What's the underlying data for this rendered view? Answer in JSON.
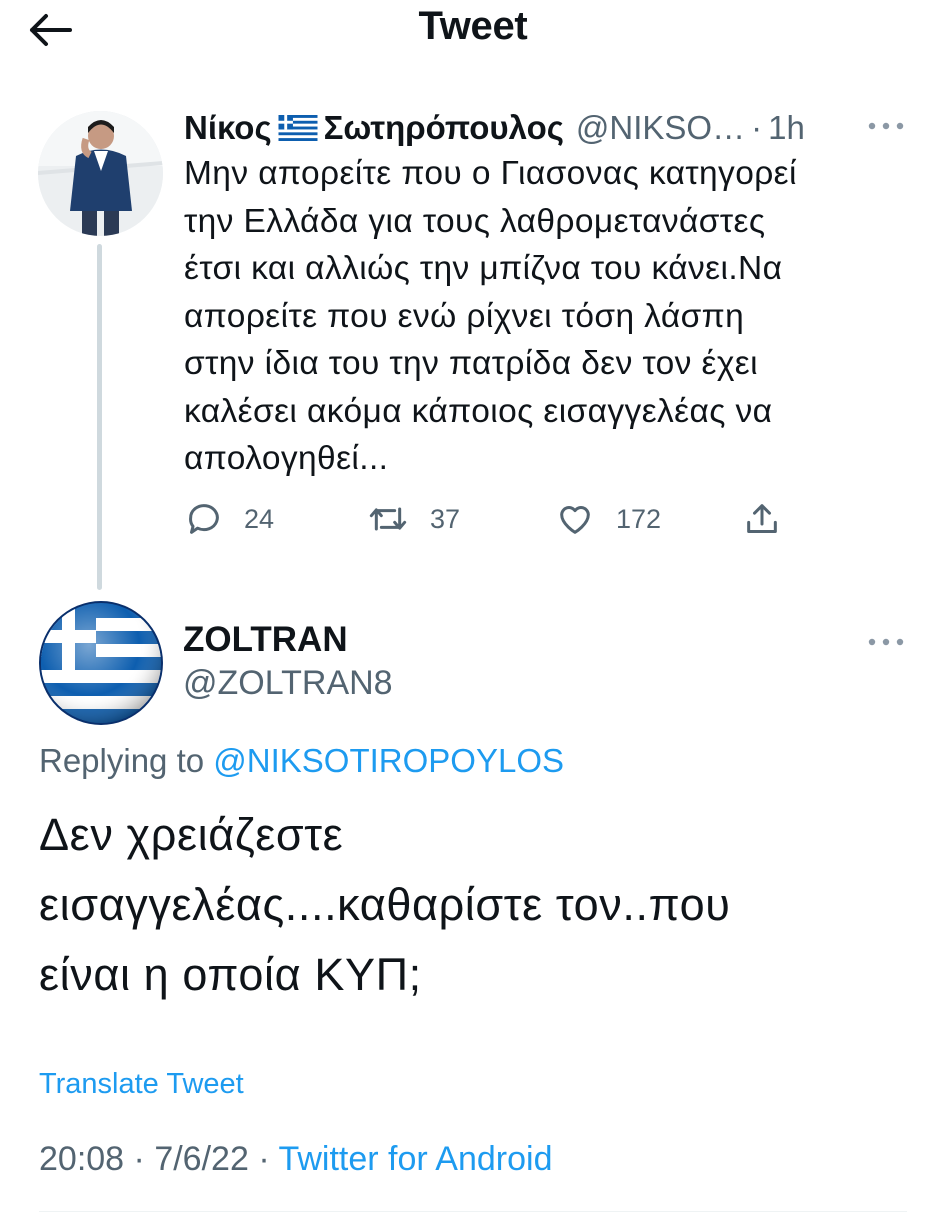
{
  "header": {
    "title": "Tweet",
    "back_icon": "arrow-left-icon"
  },
  "parent_tweet": {
    "name_first": "Νίκος",
    "name_last": "Σωτηρόπουλος",
    "flag_icon": "greek-flag-icon",
    "handle": "@NIKSO…",
    "separator": "·",
    "time": "1h",
    "text": "Μην απορείτε που ο Γιασονας κατηγορεί\nτην Ελλάδα για τους λαθρομετανάστες\nέτσι και αλλιώς την μπίζνα του κάνει.Να\nαπορείτε που ενώ ρίχνει τόση λάσπη\nστην ίδια του την πατρίδα δεν τον έχει\nκαλέσει ακόμα κάποιος εισαγγελέας να\nαπολογηθεί...",
    "actions": {
      "replies": "24",
      "retweets": "37",
      "likes": "172"
    }
  },
  "reply_tweet": {
    "name": "ZOLTRAN",
    "handle": "@ZOLTRAN8",
    "replying_prefix": "Replying to ",
    "replying_to": "@NIKSOTIROPOYLOS",
    "text": "Δεν χρειάζεστε\nεισαγγελέας....καθαρίστε τον..που\nείναι η οποία ΚΥΠ;",
    "translate_label": "Translate Tweet",
    "time": "20:08",
    "date": "7/6/22",
    "separator": "·",
    "source": "Twitter for Android"
  },
  "colors": {
    "text": "#0f1419",
    "secondary": "#536471",
    "accent": "#1d9bf0",
    "thread_line": "#cfd9de",
    "greek_blue": "#0d5eaf"
  }
}
